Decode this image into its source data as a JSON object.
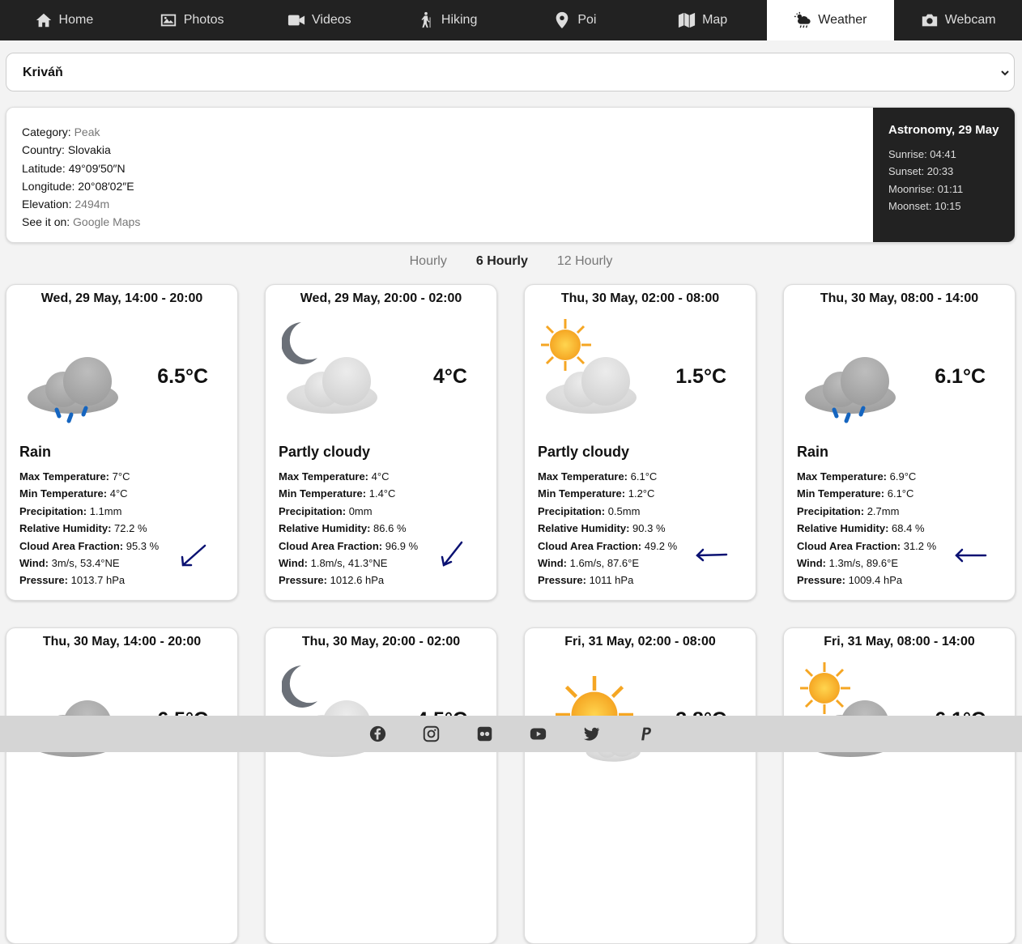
{
  "nav": {
    "items": [
      {
        "label": "Home",
        "icon": "home-icon"
      },
      {
        "label": "Photos",
        "icon": "image-icon"
      },
      {
        "label": "Videos",
        "icon": "video-icon"
      },
      {
        "label": "Hiking",
        "icon": "hiker-icon"
      },
      {
        "label": "Poi",
        "icon": "map-pin-icon"
      },
      {
        "label": "Map",
        "icon": "map-icon"
      },
      {
        "label": "Weather",
        "icon": "cloud-sun-rain-icon",
        "active": true
      },
      {
        "label": "Webcam",
        "icon": "camera-icon"
      }
    ]
  },
  "location_select": {
    "value": "Kriváň"
  },
  "info": {
    "category_label": "Category:",
    "category": "Peak",
    "country_label": "Country:",
    "country": "Slovakia",
    "latitude_label": "Latitude:",
    "latitude": "49°09′50″N",
    "longitude_label": "Longitude:",
    "longitude": "20°08′02″E",
    "elevation_label": "Elevation:",
    "elevation": "2494m",
    "see_label": "See it on:",
    "see_link": "Google Maps"
  },
  "astronomy": {
    "title": "Astronomy, 29 May",
    "sunrise": "Sunrise: 04:41",
    "sunset": "Sunset: 20:33",
    "moonrise": "Moonrise: 01:11",
    "moonset": "Moonset: 10:15"
  },
  "tabs": [
    {
      "label": "Hourly",
      "active": false
    },
    {
      "label": "6 Hourly",
      "active": true
    },
    {
      "label": "12 Hourly",
      "active": false
    }
  ],
  "labels": {
    "max_temp": "Max Temperature:",
    "min_temp": "Min Temperature:",
    "precip": "Precipitation:",
    "humidity": "Relative Humidity:",
    "cloud": "Cloud Area Fraction:",
    "wind": "Wind:",
    "pressure": "Pressure:"
  },
  "cards": [
    {
      "title": "Wed, 29 May, 14:00 - 20:00",
      "icon": "rain-icon",
      "temp": "6.5°C",
      "condition": "Rain",
      "max_temp": "7°C",
      "min_temp": "4°C",
      "precip": "1.1mm",
      "humidity": "72.2 %",
      "cloud": "95.3 %",
      "wind": "3m/s, 53.4°NE",
      "pressure": "1013.7 hPa",
      "wind_dir_deg": 53.4
    },
    {
      "title": "Wed, 29 May, 20:00 - 02:00",
      "icon": "partly-cloudy-night-icon",
      "temp": "4°C",
      "condition": "Partly cloudy",
      "max_temp": "4°C",
      "min_temp": "1.4°C",
      "precip": "0mm",
      "humidity": "86.6 %",
      "cloud": "96.9 %",
      "wind": "1.8m/s, 41.3°NE",
      "pressure": "1012.6 hPa",
      "wind_dir_deg": 41.3
    },
    {
      "title": "Thu, 30 May, 02:00 - 08:00",
      "icon": "partly-cloudy-day-icon",
      "temp": "1.5°C",
      "condition": "Partly cloudy",
      "max_temp": "6.1°C",
      "min_temp": "1.2°C",
      "precip": "0.5mm",
      "humidity": "90.3 %",
      "cloud": "49.2 %",
      "wind": "1.6m/s, 87.6°E",
      "pressure": "1011 hPa",
      "wind_dir_deg": 87.6
    },
    {
      "title": "Thu, 30 May, 08:00 - 14:00",
      "icon": "rain-icon",
      "temp": "6.1°C",
      "condition": "Rain",
      "max_temp": "6.9°C",
      "min_temp": "6.1°C",
      "precip": "2.7mm",
      "humidity": "68.4 %",
      "cloud": "31.2 %",
      "wind": "1.3m/s, 89.6°E",
      "pressure": "1009.4 hPa",
      "wind_dir_deg": 89.6
    },
    {
      "title": "Thu, 30 May, 14:00 - 20:00",
      "icon": "cloud-icon",
      "temp": "6.5°C"
    },
    {
      "title": "Thu, 30 May, 20:00 - 02:00",
      "icon": "partly-cloudy-night-icon",
      "temp": "4.5°C"
    },
    {
      "title": "Fri, 31 May, 02:00 - 08:00",
      "icon": "sun-icon",
      "temp": "3.8°C"
    },
    {
      "title": "Fri, 31 May, 08:00 - 14:00",
      "icon": "partly-cloudy-day-icon",
      "temp": "6.1°C"
    }
  ],
  "footer": {
    "icons": [
      "facebook-icon",
      "instagram-icon",
      "flickr-icon",
      "youtube-icon",
      "twitter-icon",
      "paypal-icon"
    ]
  },
  "colors": {
    "nav_bg": "#222222",
    "astro_bg": "#222222",
    "rain": "#1565c0",
    "wind_arrow": "#0a1172",
    "sun": "#f5a623",
    "footer_bg": "#d5d5d5"
  }
}
